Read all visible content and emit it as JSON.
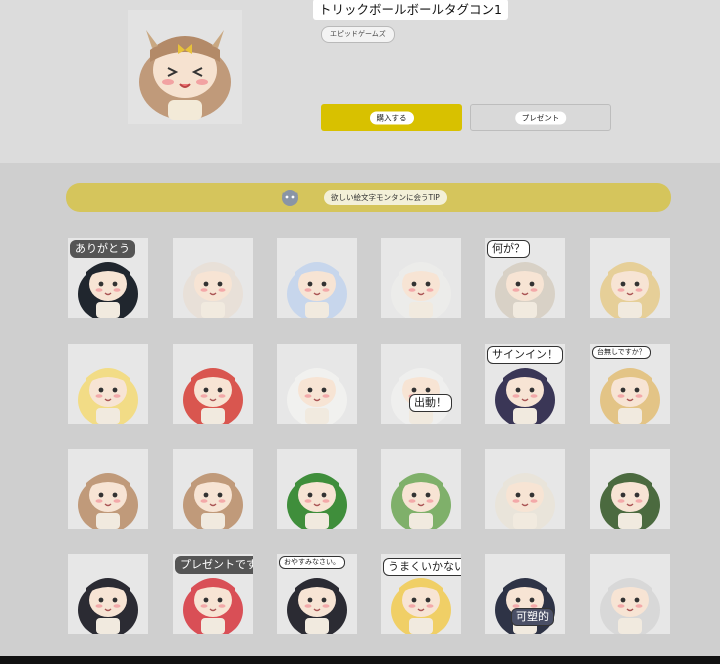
{
  "product": {
    "title": "トリックボールボールタグコン1",
    "publisher": "エピッドゲームズ",
    "buy_label": "購入する",
    "gift_label": "プレゼント"
  },
  "tip": {
    "label": "欲しい絵文字モンタンに会うTIP"
  },
  "colors": {
    "accent": "#d8c100",
    "tip_bar": "#d5c55c",
    "page_bg": "#cfcfcf"
  },
  "stickers": [
    {
      "name": "sticker-1",
      "caption": "ありがとう",
      "hair": "#20262e"
    },
    {
      "name": "sticker-2",
      "caption": "",
      "hair": "#e8e0d8"
    },
    {
      "name": "sticker-3",
      "caption": "",
      "hair": "#c7d6ec"
    },
    {
      "name": "sticker-4",
      "caption": "",
      "hair": "#ececea"
    },
    {
      "name": "sticker-5",
      "caption": "何が？",
      "hair": "#d8d1c6"
    },
    {
      "name": "sticker-6",
      "caption": "",
      "hair": "#e6cf98"
    },
    {
      "name": "sticker-7",
      "caption": "",
      "hair": "#f2dc86"
    },
    {
      "name": "sticker-8",
      "caption": "",
      "hair": "#d9564f"
    },
    {
      "name": "sticker-9",
      "caption": "",
      "hair": "#f1f1ef"
    },
    {
      "name": "sticker-10",
      "caption": "出動！",
      "hair": "#efefee"
    },
    {
      "name": "sticker-11",
      "caption": "サインイン！",
      "hair": "#3a3656"
    },
    {
      "name": "sticker-12",
      "caption": "台無しですか？",
      "hair": "#e3c486"
    },
    {
      "name": "sticker-13",
      "caption": "",
      "hair": "#c09a7a"
    },
    {
      "name": "sticker-14",
      "caption": "",
      "hair": "#c09a7a"
    },
    {
      "name": "sticker-15",
      "caption": "",
      "hair": "#3f8e3b"
    },
    {
      "name": "sticker-16",
      "caption": "",
      "hair": "#7fb06a"
    },
    {
      "name": "sticker-17",
      "caption": "",
      "hair": "#e9e4da"
    },
    {
      "name": "sticker-18",
      "caption": "",
      "hair": "#4b6a3f"
    },
    {
      "name": "sticker-19",
      "caption": "",
      "hair": "#2b2b33"
    },
    {
      "name": "sticker-20",
      "caption": "プレゼントです！",
      "hair": "#d94f56"
    },
    {
      "name": "sticker-21",
      "caption": "おやすみなさい。",
      "hair": "#2b2b33"
    },
    {
      "name": "sticker-22",
      "caption": "うまくいかない",
      "hair": "#f0cf66"
    },
    {
      "name": "sticker-23",
      "caption": "可塑的",
      "hair": "#2e3346"
    },
    {
      "name": "sticker-24",
      "caption": "",
      "hair": "#d8d8d8"
    }
  ]
}
